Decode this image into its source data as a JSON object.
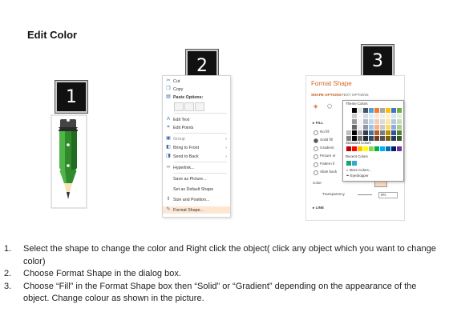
{
  "title": "Edit Color",
  "badges": [
    "1",
    "2",
    "3"
  ],
  "context_menu": {
    "items": [
      {
        "label": "Cut",
        "icon": "scissors-icon"
      },
      {
        "label": "Copy",
        "icon": "copy-icon"
      },
      {
        "label": "Paste Options:",
        "icon": "clipboard-icon"
      },
      {
        "label": "Edit Text",
        "icon": "text-edit-icon"
      },
      {
        "label": "Edit Points",
        "icon": "edit-points-icon"
      },
      {
        "label": "Group",
        "icon": "group-icon",
        "submenu": true
      },
      {
        "label": "Bring to Front",
        "icon": "bring-front-icon",
        "submenu": true
      },
      {
        "label": "Send to Back",
        "icon": "send-back-icon",
        "submenu": true
      },
      {
        "label": "Hyperlink...",
        "icon": "hyperlink-icon"
      },
      {
        "label": "Save as Picture...",
        "icon": ""
      },
      {
        "label": "Set as Default Shape",
        "icon": ""
      },
      {
        "label": "Size and Position...",
        "icon": "size-position-icon"
      },
      {
        "label": "Format Shape...",
        "icon": "format-shape-icon",
        "highlighted": true
      }
    ]
  },
  "format_pane": {
    "title": "Format Shape",
    "tab_shape": "SHAPE OPTIONS",
    "tab_text": "TEXT OPTIONS",
    "fill_section": "FILL",
    "fill_options": [
      "No fill",
      "Solid fill",
      "Gradient",
      "Picture or",
      "Pattern fi",
      "Slide back"
    ],
    "selected_fill": "Solid fill",
    "color_label": "Color",
    "transparency_label": "Transparency",
    "transparency_value": "0%",
    "line_section": "LINE"
  },
  "color_picker": {
    "theme_header": "Theme Colors",
    "standard_header": "Standard Colors",
    "recent_header": "Recent Colors",
    "more_colors": "More Colors...",
    "eyedropper": "Eyedropper",
    "theme_top": [
      "#ffffff",
      "#000000",
      "#e7e6e6",
      "#44546a",
      "#5b9bd5",
      "#ed7d31",
      "#a5a5a5",
      "#ffc000",
      "#4472c4",
      "#70ad47"
    ],
    "standard": [
      "#c00000",
      "#ff0000",
      "#ffc000",
      "#ffff00",
      "#92d050",
      "#00b050",
      "#00b0f0",
      "#0070c0",
      "#002060",
      "#7030a0"
    ],
    "recent": [
      "#1fa07c",
      "#3aa6c9"
    ]
  },
  "steps": [
    {
      "num": "1.",
      "text": "Select the shape to change the color and Right click the object( click any object which you want to change color)"
    },
    {
      "num": "2.",
      "text": "Choose Format Shape in the dialog box."
    },
    {
      "num": "3.",
      "text": "Choose “Fill” in the Format Shape box then “Solid” or “Gradient” depending on the appearance of the object. Change colour as shown in the picture."
    }
  ]
}
